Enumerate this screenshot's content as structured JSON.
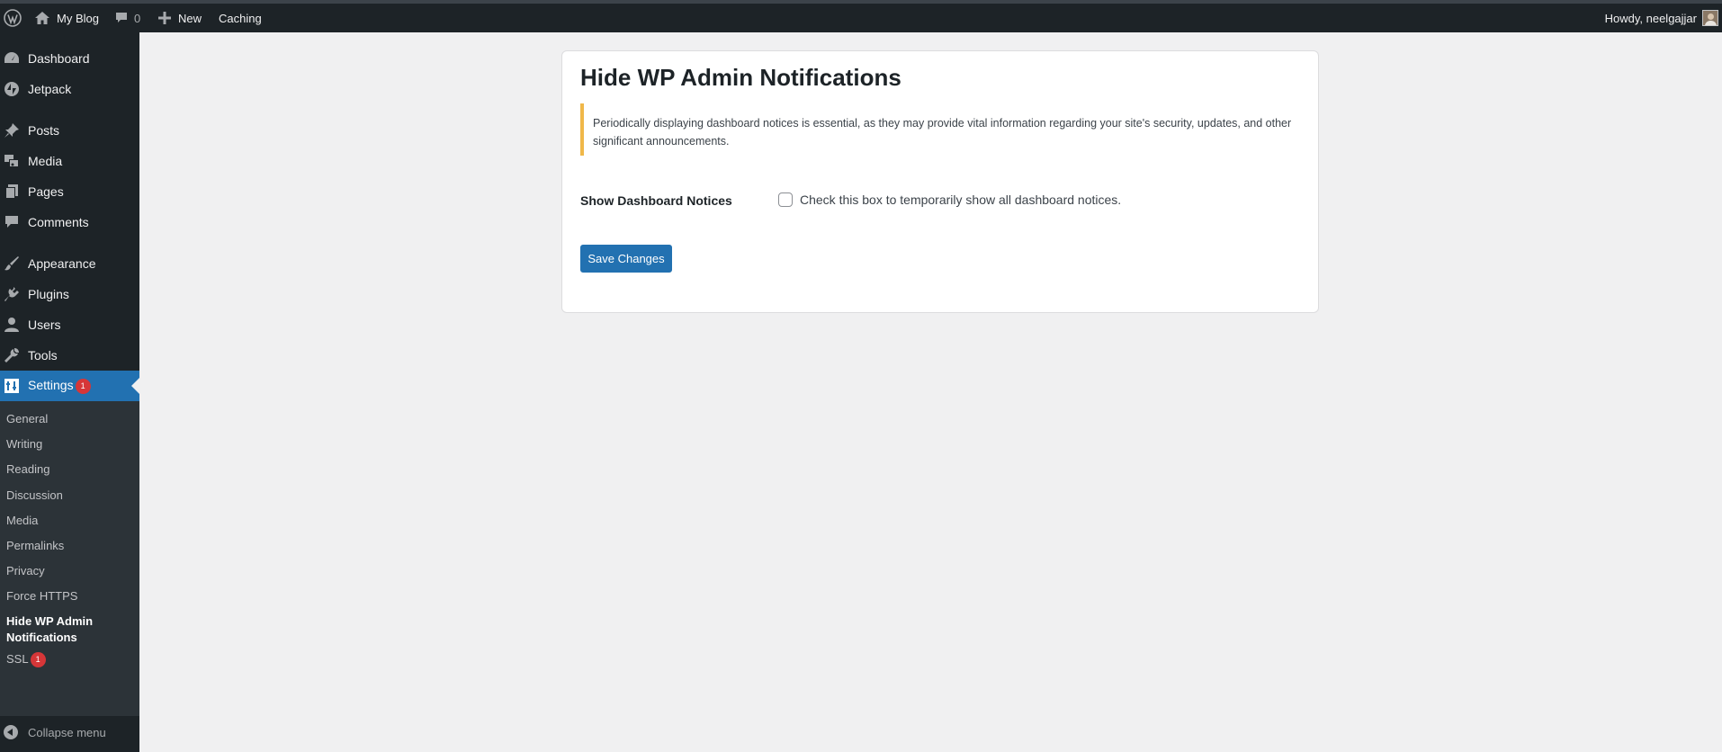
{
  "admin_bar": {
    "site_name": "My Blog",
    "comments_count": "0",
    "new_label": "New",
    "caching_label": "Caching",
    "howdy": "Howdy, neelgajjar"
  },
  "sidebar": {
    "items": [
      {
        "label": "Dashboard",
        "icon": "dashboard-icon"
      },
      {
        "label": "Jetpack",
        "icon": "jetpack-icon"
      },
      {
        "label": "Posts",
        "icon": "pushpin-icon"
      },
      {
        "label": "Media",
        "icon": "media-icon"
      },
      {
        "label": "Pages",
        "icon": "pages-icon"
      },
      {
        "label": "Comments",
        "icon": "comment-bubble-icon"
      },
      {
        "label": "Appearance",
        "icon": "paintbrush-icon"
      },
      {
        "label": "Plugins",
        "icon": "plugin-icon"
      },
      {
        "label": "Users",
        "icon": "user-icon"
      },
      {
        "label": "Tools",
        "icon": "wrench-icon"
      },
      {
        "label": "Settings",
        "icon": "settings-icon",
        "badge": "1",
        "current": true
      }
    ],
    "submenu": [
      {
        "label": "General"
      },
      {
        "label": "Writing"
      },
      {
        "label": "Reading"
      },
      {
        "label": "Discussion"
      },
      {
        "label": "Media"
      },
      {
        "label": "Permalinks"
      },
      {
        "label": "Privacy"
      },
      {
        "label": "Force HTTPS"
      },
      {
        "label": "Hide WP Admin Notifications",
        "current": true
      },
      {
        "label": "SSL",
        "badge": "1"
      }
    ],
    "collapse_label": "Collapse menu"
  },
  "main": {
    "title": "Hide WP Admin Notifications",
    "notice": "Periodically displaying dashboard notices is essential, as they may provide vital information regarding your site's security, updates, and other significant announcements.",
    "field_label": "Show Dashboard Notices",
    "checkbox_label": "Check this box to temporarily show all dashboard notices.",
    "checkbox_checked": false,
    "save_label": "Save Changes"
  },
  "colors": {
    "admin_dark": "#1d2327",
    "submenu_bg": "#2c3338",
    "accent": "#2271b1",
    "notice_border": "#f0b849",
    "badge": "#d63638",
    "page_bg": "#f0f0f1"
  }
}
